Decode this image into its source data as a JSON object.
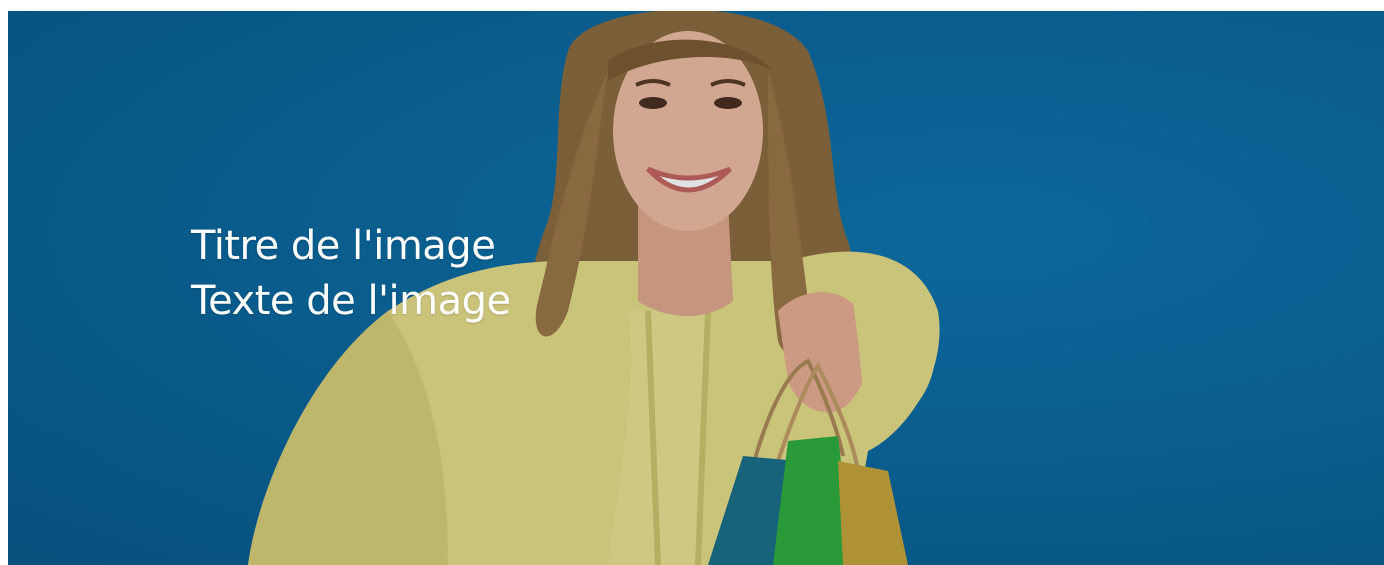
{
  "slide": {
    "title": "Titre de l'image",
    "text": "Texte de l'image",
    "image_alt": "woman-with-shopping-bags"
  },
  "colors": {
    "background": "#0a6aa0",
    "sweater": "#e9df84",
    "text": "#ffffff"
  }
}
